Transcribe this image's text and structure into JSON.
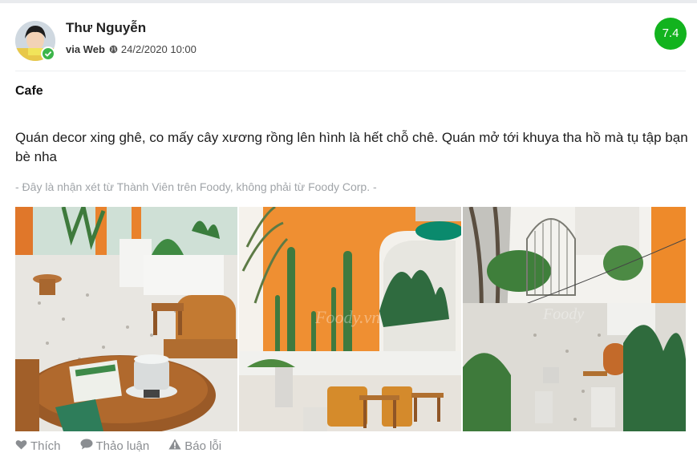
{
  "post": {
    "author": "Thư Nguyễn",
    "via_label": "via Web",
    "date": "24/2/2020 10:00",
    "score": "7.4",
    "title": "Cafe",
    "body": "Quán decor xing ghê, co mấy cây xương rồng lên hình là hết chỗ chê. Quán mở tới khuya tha hồ mà tụ tập bạn bè nha",
    "disclaimer": "- Đây là nhận xét từ Thành Viên trên Foody, không phải từ Foody Corp. -",
    "photos": [
      {
        "subject": "round wooden table with phin coffee and stools"
      },
      {
        "subject": "orange wall with tall cacti and wooden stools"
      },
      {
        "subject": "courtyard with white pebbles, plants and bird cage"
      }
    ],
    "watermark": "Foody.vn"
  },
  "actions": {
    "like": "Thích",
    "discuss": "Thảo luận",
    "report": "Báo lỗi"
  },
  "colors": {
    "score_bg": "#12b31e",
    "verified": "#3cb54a",
    "muted": "#8a8d91",
    "wall_orange": "#f0892a"
  },
  "icons": [
    "globe-icon",
    "heart-icon",
    "comment-icon",
    "warning-icon",
    "check-icon"
  ]
}
